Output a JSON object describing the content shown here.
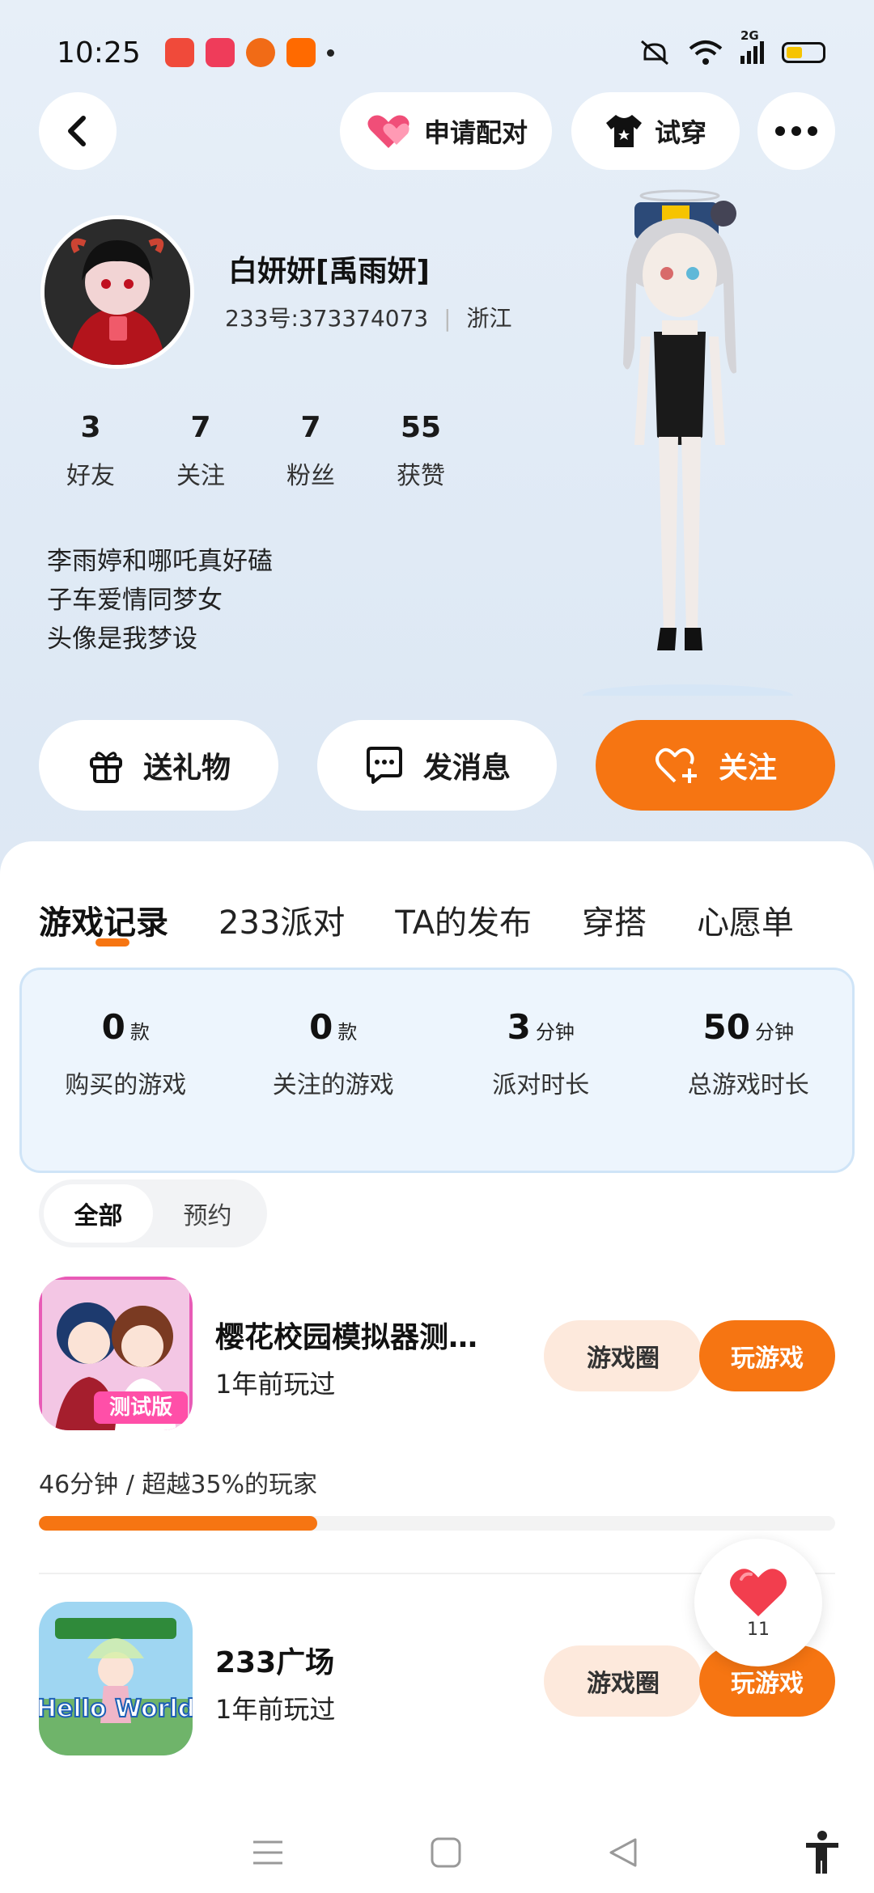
{
  "status_bar": {
    "time": "10:25",
    "network": "2G",
    "battery_level": 0.45
  },
  "header": {
    "pair_label": "申请配对",
    "tryon_label": "试穿"
  },
  "profile": {
    "nickname": "白妍妍[禹雨妍]",
    "id_line": "233号:373374073",
    "region": "浙江",
    "stats": [
      {
        "value": "3",
        "label": "好友"
      },
      {
        "value": "7",
        "label": "关注"
      },
      {
        "value": "7",
        "label": "粉丝"
      },
      {
        "value": "55",
        "label": "获赞"
      }
    ],
    "bio": [
      "李雨婷和哪吒真好磕",
      "子车爱情同梦女",
      "头像是我梦设"
    ]
  },
  "actions": {
    "gift": "送礼物",
    "message": "发消息",
    "follow": "关注"
  },
  "tabs": [
    "游戏记录",
    "233派对",
    "TA的发布",
    "穿搭",
    "心愿单"
  ],
  "summary": [
    {
      "value": "0",
      "unit": "款",
      "label": "购买的游戏"
    },
    {
      "value": "0",
      "unit": "款",
      "label": "关注的游戏"
    },
    {
      "value": "3",
      "unit": "分钟",
      "label": "派对时长"
    },
    {
      "value": "50",
      "unit": "分钟",
      "label": "总游戏时长"
    }
  ],
  "segment": [
    "全部",
    "预约"
  ],
  "games": [
    {
      "title": "樱花校园模拟器测…",
      "played": "1年前玩过",
      "badge": "测试版",
      "circle_label": "游戏圈",
      "play_label": "玩游戏",
      "progress_text": "46分钟 / 超越35%的玩家",
      "progress": 0.35
    },
    {
      "title": "233广场",
      "played": "1年前玩过",
      "badge": "Hello World",
      "circle_label": "游戏圈",
      "play_label": "玩游戏"
    }
  ],
  "fab": {
    "count": "11"
  },
  "colors": {
    "accent": "#f67512",
    "accent_soft": "#fde9dc",
    "summary_bg": "#edf5fd"
  }
}
